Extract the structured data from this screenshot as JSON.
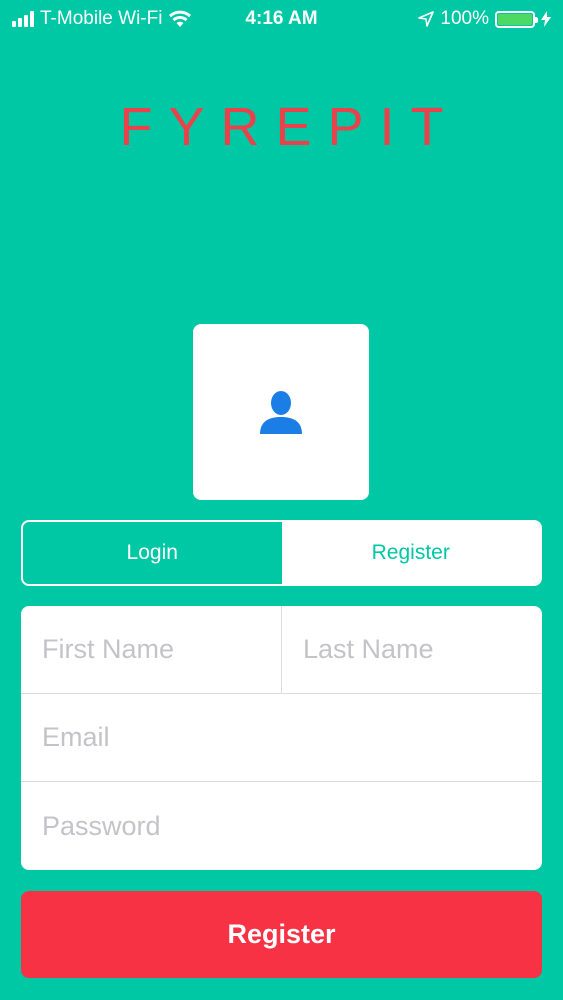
{
  "status_bar": {
    "carrier": "T-Mobile Wi-Fi",
    "time": "4:16 AM",
    "battery": "100%"
  },
  "app": {
    "logo": "FYREPIT"
  },
  "segment": {
    "login_label": "Login",
    "register_label": "Register",
    "selected": "Register"
  },
  "form": {
    "first_name_placeholder": "First Name",
    "last_name_placeholder": "Last Name",
    "email_placeholder": "Email",
    "password_placeholder": "Password"
  },
  "actions": {
    "register_label": "Register"
  },
  "colors": {
    "background": "#00c7a4",
    "logo": "#e9424b",
    "button": "#f83245",
    "avatar_icon": "#1a7ee6"
  }
}
